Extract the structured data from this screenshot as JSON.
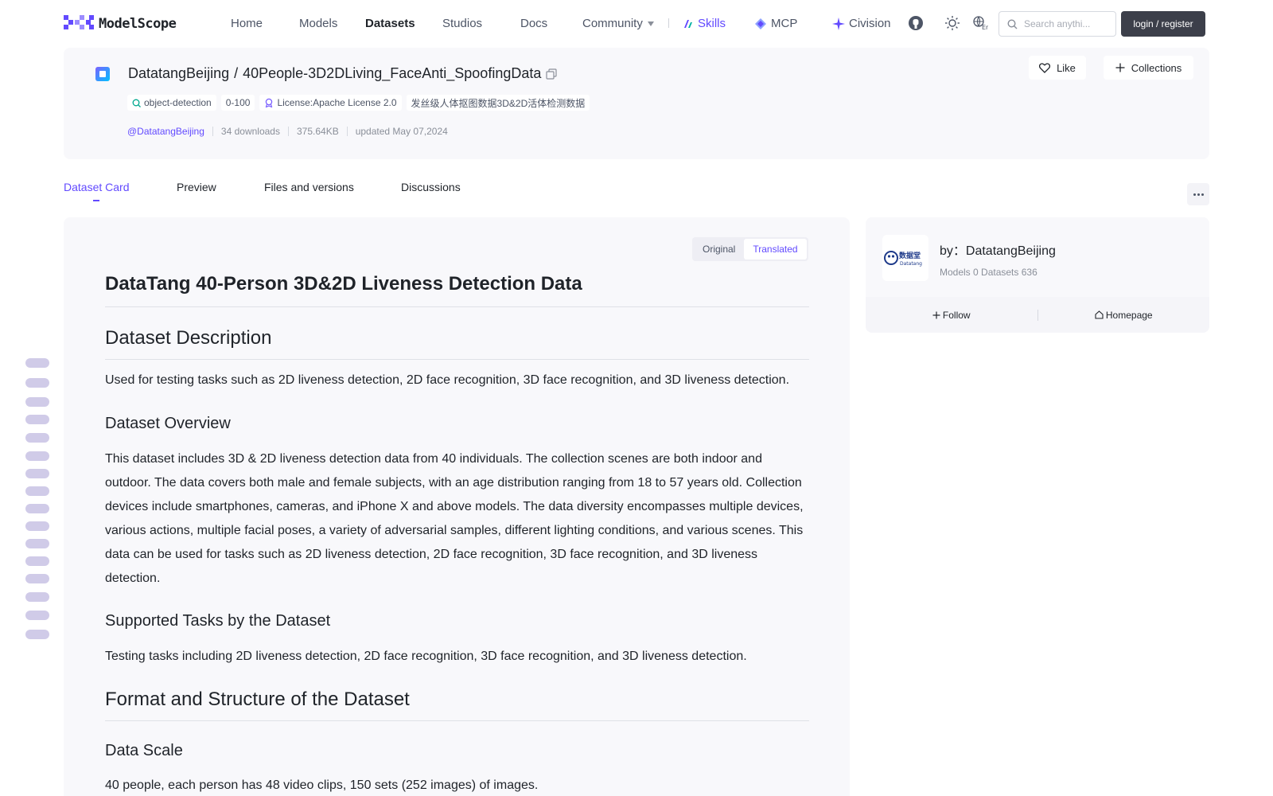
{
  "nav": {
    "logo_text": "ModelScope",
    "links": [
      "Home",
      "Models",
      "Datasets",
      "Studios",
      "Docs"
    ],
    "community": "Community",
    "skills": "Skills",
    "mcp": "MCP",
    "civision": "Civision",
    "search_placeholder": "Search anythi...",
    "login": "login / register",
    "accent": "#624aff"
  },
  "dataset": {
    "owner": "DatatangBeijing",
    "sep": "/",
    "name": "40People-3D2DLiving_FaceAnti_SpoofingData",
    "tags": {
      "task": "object-detection",
      "size": "0-100",
      "license": "License:Apache License 2.0",
      "cn_desc": "发丝级人体抠图数据3D&2D活体检测数据"
    },
    "meta": {
      "owner_handle": "@DatatangBeijing",
      "downloads": "34 downloads",
      "filesize": "375.64KB",
      "updated": "updated May 07,2024"
    },
    "like": "Like",
    "collections": "Collections"
  },
  "tabs": [
    "Dataset Card",
    "Preview",
    "Files and versions",
    "Discussions"
  ],
  "toggle": {
    "original": "Original",
    "translated": "Translated"
  },
  "card": {
    "title": "DataTang 40-Person 3D&2D Liveness Detection Data",
    "desc_heading": "Dataset Description",
    "desc_text": "Used for testing tasks such as 2D liveness detection, 2D face recognition, 3D face recognition, and 3D liveness detection.",
    "overview_heading": "Dataset Overview",
    "overview_text": "This dataset includes 3D & 2D liveness detection data from 40 individuals. The collection scenes are both indoor and outdoor. The data covers both male and female subjects, with an age distribution ranging from 18 to 57 years old. Collection devices include smartphones, cameras, and iPhone X and above models. The data diversity encompasses multiple devices, various actions, multiple facial poses, a variety of adversarial samples, different lighting conditions, and various scenes. This data can be used for tasks such as 2D liveness detection, 2D face recognition, 3D face recognition, and 3D liveness detection.",
    "tasks_heading": "Supported Tasks by the Dataset",
    "tasks_text": "Testing tasks including 2D liveness detection, 2D face recognition, 3D face recognition, and 3D liveness detection.",
    "format_heading": "Format and Structure of the Dataset",
    "scale_heading": "Data Scale",
    "scale_text": "40 people, each person has 48 video clips, 150 sets (252 images) of images."
  },
  "org": {
    "by": "by：DatatangBeijing",
    "stats": "Models 0  Datasets 636",
    "logo_text": "数据堂",
    "logo_sub": "Datatang",
    "follow": "Follow",
    "homepage": "Homepage"
  }
}
